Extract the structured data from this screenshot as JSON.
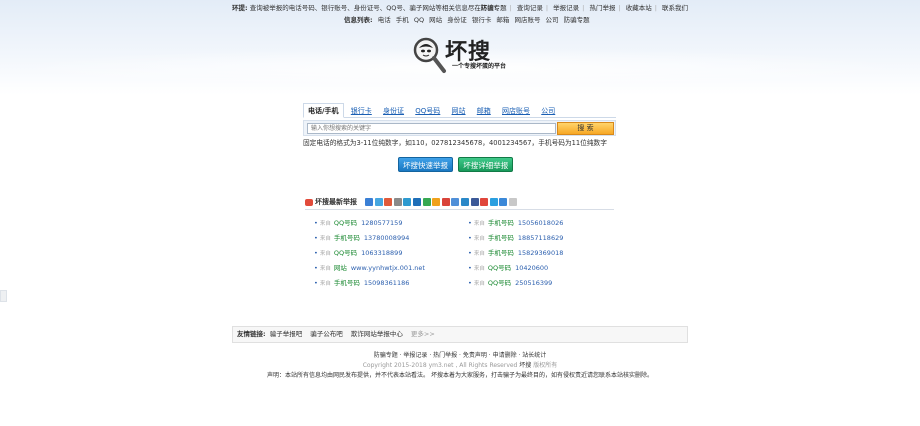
{
  "topbar": {
    "tip_title": "环提:",
    "tip_text": "查询被举报的电话号码、银行账号、身份证号、QQ号、骗子网站等相关信息尽在环搜!",
    "nav": [
      "防骗专题",
      "查询记录",
      "举报记录",
      "热门举报",
      "收藏本站",
      "联系我们"
    ]
  },
  "infolist": {
    "label": "信息列表:",
    "items": [
      "电话",
      "手机",
      "QQ",
      "网站",
      "身份证",
      "银行卡",
      "邮箱",
      "网店账号",
      "公司",
      "防骗专题"
    ]
  },
  "logo": {
    "text": "坏搜",
    "slogan": "一个专搜坏蛋的平台"
  },
  "search": {
    "tabs": [
      "电话/手机",
      "银行卡",
      "身份证",
      "QQ号码",
      "网站",
      "邮箱",
      "网店账号",
      "公司"
    ],
    "placeholder": "输入你想搜索的关键字",
    "button": "搜 索",
    "hint": "固定电话的格式为3-11位纯数字，如110，027812345678，4001234567，手机号码为11位纯数字"
  },
  "report": {
    "quick": "坏搜快速举报",
    "detail": "坏搜详细举报"
  },
  "latest": {
    "title": "坏搜最新举报",
    "share_colors": [
      "#3a7fd5",
      "#46a6e0",
      "#e05a3a",
      "#8a8a8a",
      "#2e9ad0",
      "#1e6fb8",
      "#36a852",
      "#f0a11b",
      "#d9433a",
      "#4f8fd8",
      "#2a88c8",
      "#3b5998",
      "#e0463b",
      "#2a9fe0",
      "#3b88d8",
      "#c8c8c8"
    ],
    "left": [
      {
        "src": "来自",
        "cat": "QQ号码",
        "val": "1280577159"
      },
      {
        "src": "来自",
        "cat": "手机号码",
        "val": "13780008994"
      },
      {
        "src": "来自",
        "cat": "QQ号码",
        "val": "1063318899"
      },
      {
        "src": "来自",
        "cat": "网站",
        "val": "www.yynhwtjx.001.net"
      },
      {
        "src": "来自",
        "cat": "手机号码",
        "val": "15098361186"
      }
    ],
    "right": [
      {
        "src": "来自",
        "cat": "手机号码",
        "val": "15056018026"
      },
      {
        "src": "来自",
        "cat": "手机号码",
        "val": "18857118629"
      },
      {
        "src": "来自",
        "cat": "手机号码",
        "val": "15829369018"
      },
      {
        "src": "来自",
        "cat": "QQ号码",
        "val": "10420600"
      },
      {
        "src": "来自",
        "cat": "QQ号码",
        "val": "250516399"
      }
    ]
  },
  "friends": {
    "label": "友情链接:",
    "links": [
      "骗子举报吧",
      "骗子公布吧",
      "欺诈网站举报中心"
    ],
    "more": "更多>>"
  },
  "footer": {
    "links": "防骗专题 · 举报记录 · 热门举报 · 免责声明 · 申请删除 · 站长统计",
    "copyright": "Copyright 2015-2018 ym3.net , All Rights Reserved",
    "brand": "坏搜",
    "rights": "版权所有",
    "notice": "声明：本站所有信息均由网民发布提供，并不代表本站看法。 坏搜本着为大家服务，打击骗子为最终目的，如有侵权责近请您联系本站核实删除。"
  }
}
